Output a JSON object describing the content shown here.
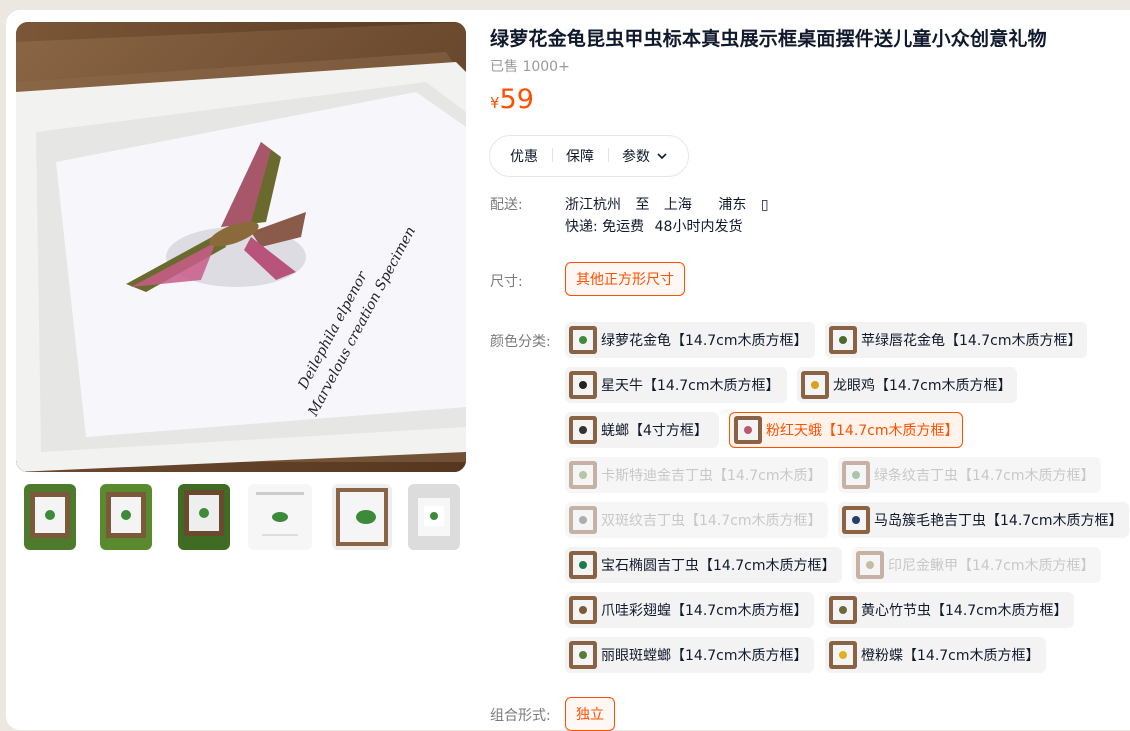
{
  "product": {
    "title": "绿萝花金龟昆虫甲虫标本真虫展示框桌面摆件送儿童小众创意礼物",
    "sold": "已售 1000+",
    "currency": "¥",
    "price": "59"
  },
  "photo": {
    "caption_line1": "Deilephila elpenor",
    "caption_line2": "Marvelous creation Specimen"
  },
  "thumbnails": [
    {
      "icon": "beetle-frame-thumb",
      "bg": "#4d7a2c"
    },
    {
      "icon": "beetle-frame-thumb",
      "bg": "#5a8a2e"
    },
    {
      "icon": "beetle-frame-thumb",
      "bg": "#3f6b22"
    },
    {
      "icon": "info-card-thumb",
      "bg": "#f4f4f4"
    },
    {
      "icon": "beetle-closeup-thumb",
      "bg": "#e8e8e8"
    },
    {
      "icon": "white-frame-thumb",
      "bg": "#dcdcdc"
    }
  ],
  "pills": {
    "discount": "优惠",
    "guarantee": "保障",
    "params": "参数"
  },
  "delivery": {
    "label": "配送:",
    "from": "浙江杭州",
    "to_word": "至",
    "city": "上海",
    "district": "浦东",
    "location_icon": "▯",
    "express": "快递: 免运费",
    "ship_time": "48小时内发货"
  },
  "size": {
    "label": "尺寸:",
    "option": "其他正方形尺寸"
  },
  "color": {
    "label": "颜色分类:",
    "options": [
      {
        "label": "绿萝花金龟【14.7cm木质方框】",
        "state": "normal",
        "dot": "#3c8a3a"
      },
      {
        "label": "苹绿唇花金龟【14.7cm木质方框】",
        "state": "normal",
        "dot": "#4a6b2a"
      },
      {
        "label": "星天牛【14.7cm木质方框】",
        "state": "normal",
        "dot": "#222222"
      },
      {
        "label": "龙眼鸡【14.7cm木质方框】",
        "state": "normal",
        "dot": "#d9a21a"
      },
      {
        "label": "蜣螂【4寸方框】",
        "state": "normal",
        "dot": "#333333"
      },
      {
        "label": "粉红天蛾【14.7cm木质方框】",
        "state": "selected",
        "dot": "#b85a6a"
      },
      {
        "label": "卡斯特迪金吉丁虫【14.7cm木质】",
        "state": "disabled",
        "dot": "#6a8a4a"
      },
      {
        "label": "绿条纹吉丁虫【14.7cm木质方框】",
        "state": "disabled",
        "dot": "#4a8a5a"
      },
      {
        "label": "双斑纹吉丁虫【14.7cm木质方框】",
        "state": "disabled",
        "dot": "#555555"
      },
      {
        "label": "马岛簇毛艳吉丁虫【14.7cm木质方框】",
        "state": "normal",
        "dot": "#2a3a6a"
      },
      {
        "label": "宝石椭圆吉丁虫【14.7cm木质方框】",
        "state": "normal",
        "dot": "#1f7a4a"
      },
      {
        "label": "印尼金鳅甲【14.7cm木质方框】",
        "state": "disabled",
        "dot": "#8a7a3a"
      },
      {
        "label": "爪哇彩翅蝗【14.7cm木质方框】",
        "state": "normal",
        "dot": "#7a5a3a"
      },
      {
        "label": "黄心竹节虫【14.7cm木质方框】",
        "state": "normal",
        "dot": "#6a6a3a"
      },
      {
        "label": "丽眼斑螳螂【14.7cm木质方框】",
        "state": "normal",
        "dot": "#5a7a3a"
      },
      {
        "label": "橙粉蝶【14.7cm木质方框】",
        "state": "normal",
        "dot": "#e0b020"
      }
    ]
  },
  "combo": {
    "label": "组合形式:",
    "option": "独立"
  },
  "colors": {
    "accent": "#ff5000",
    "background": "#ede7e1"
  }
}
